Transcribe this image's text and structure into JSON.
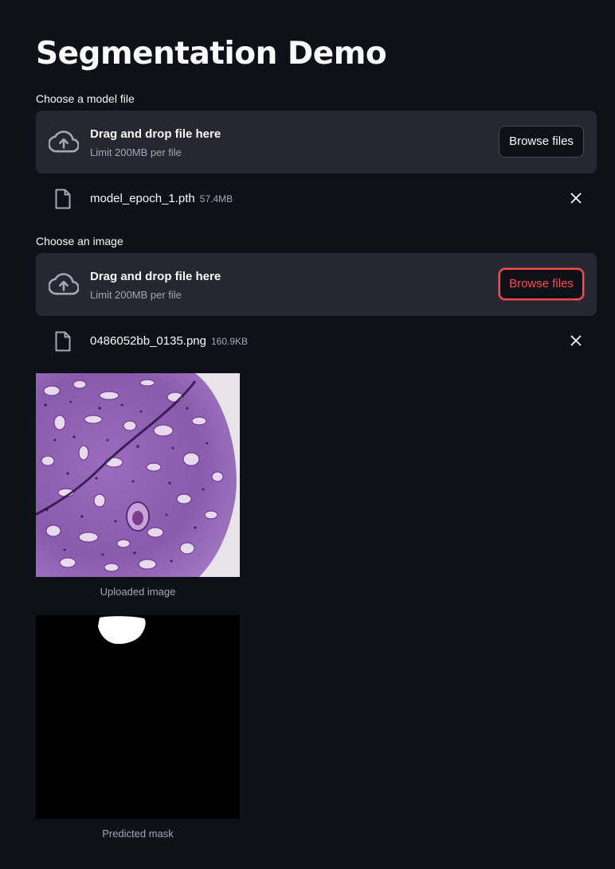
{
  "page": {
    "title": "Segmentation Demo"
  },
  "model_uploader": {
    "label": "Choose a model file",
    "dropzone_title": "Drag and drop file here",
    "dropzone_limit": "Limit 200MB per file",
    "browse_label": "Browse files",
    "file": {
      "name": "model_epoch_1.pth",
      "size": "57.4MB"
    }
  },
  "image_uploader": {
    "label": "Choose an image",
    "dropzone_title": "Drag and drop file here",
    "dropzone_limit": "Limit 200MB per file",
    "browse_label": "Browse files",
    "browse_state": "focused",
    "file": {
      "name": "0486052bb_0135.png",
      "size": "160.9KB"
    }
  },
  "outputs": {
    "uploaded_image": {
      "caption": "Uploaded image",
      "content": "histology-tissue-pas-stain"
    },
    "predicted_mask": {
      "caption": "Predicted mask",
      "content": "binary-mask"
    }
  },
  "icons": {
    "upload": "cloud-upload-icon",
    "file": "file-icon",
    "remove": "close-icon"
  },
  "colors": {
    "background": "#0e1117",
    "panel": "#262730",
    "text": "#fafafa",
    "muted_text": "#a3a8b8",
    "accent": "#ff4b4b",
    "mask_background": "#000000",
    "mask_foreground": "#ffffff",
    "tissue_primary": "#8a5aad",
    "slide_background": "#e8e3e9"
  }
}
